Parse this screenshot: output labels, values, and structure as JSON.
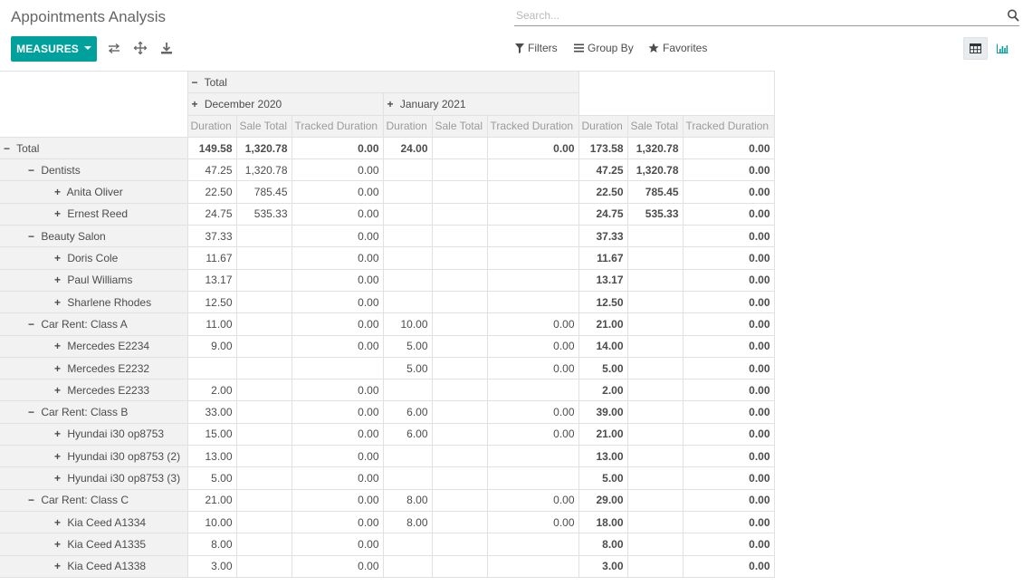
{
  "breadcrumb": "Appointments Analysis",
  "search": {
    "placeholder": "Search..."
  },
  "toolbar": {
    "measures_label": "MEASURES",
    "filters_label": "Filters",
    "groupby_label": "Group By",
    "favorites_label": "Favorites"
  },
  "colors": {
    "accent": "#00a09d",
    "header_bg": "#f2f2f2",
    "border": "#dee2e6"
  },
  "pivot": {
    "col_total_label": "Total",
    "col_groups": [
      "December 2020",
      "January 2021"
    ],
    "measures": [
      "Duration",
      "Sale Total",
      "Tracked Duration"
    ],
    "rows": [
      {
        "label": "Total",
        "level": 0,
        "expand": "minus",
        "values": [
          "149.58",
          "1,320.78",
          "0.00",
          "24.00",
          "",
          "0.00",
          "173.58",
          "1,320.78",
          "0.00"
        ]
      },
      {
        "label": "Dentists",
        "level": 1,
        "expand": "minus",
        "values": [
          "47.25",
          "1,320.78",
          "0.00",
          "",
          "",
          "",
          "47.25",
          "1,320.78",
          "0.00"
        ]
      },
      {
        "label": "Anita Oliver",
        "level": 2,
        "expand": "plus",
        "values": [
          "22.50",
          "785.45",
          "0.00",
          "",
          "",
          "",
          "22.50",
          "785.45",
          "0.00"
        ]
      },
      {
        "label": "Ernest Reed",
        "level": 2,
        "expand": "plus",
        "values": [
          "24.75",
          "535.33",
          "0.00",
          "",
          "",
          "",
          "24.75",
          "535.33",
          "0.00"
        ]
      },
      {
        "label": "Beauty Salon",
        "level": 1,
        "expand": "minus",
        "values": [
          "37.33",
          "",
          "0.00",
          "",
          "",
          "",
          "37.33",
          "",
          "0.00"
        ]
      },
      {
        "label": "Doris Cole",
        "level": 2,
        "expand": "plus",
        "values": [
          "11.67",
          "",
          "0.00",
          "",
          "",
          "",
          "11.67",
          "",
          "0.00"
        ]
      },
      {
        "label": "Paul Williams",
        "level": 2,
        "expand": "plus",
        "values": [
          "13.17",
          "",
          "0.00",
          "",
          "",
          "",
          "13.17",
          "",
          "0.00"
        ]
      },
      {
        "label": "Sharlene Rhodes",
        "level": 2,
        "expand": "plus",
        "values": [
          "12.50",
          "",
          "0.00",
          "",
          "",
          "",
          "12.50",
          "",
          "0.00"
        ]
      },
      {
        "label": "Car Rent: Class A",
        "level": 1,
        "expand": "minus",
        "values": [
          "11.00",
          "",
          "0.00",
          "10.00",
          "",
          "0.00",
          "21.00",
          "",
          "0.00"
        ]
      },
      {
        "label": "Mercedes E2234",
        "level": 2,
        "expand": "plus",
        "values": [
          "9.00",
          "",
          "0.00",
          "5.00",
          "",
          "0.00",
          "14.00",
          "",
          "0.00"
        ]
      },
      {
        "label": "Mercedes E2232",
        "level": 2,
        "expand": "plus",
        "values": [
          "",
          "",
          "",
          "5.00",
          "",
          "0.00",
          "5.00",
          "",
          "0.00"
        ]
      },
      {
        "label": "Mercedes E2233",
        "level": 2,
        "expand": "plus",
        "values": [
          "2.00",
          "",
          "0.00",
          "",
          "",
          "",
          "2.00",
          "",
          "0.00"
        ]
      },
      {
        "label": "Car Rent: Class B",
        "level": 1,
        "expand": "minus",
        "values": [
          "33.00",
          "",
          "0.00",
          "6.00",
          "",
          "0.00",
          "39.00",
          "",
          "0.00"
        ]
      },
      {
        "label": "Hyundai i30 op8753",
        "level": 2,
        "expand": "plus",
        "values": [
          "15.00",
          "",
          "0.00",
          "6.00",
          "",
          "0.00",
          "21.00",
          "",
          "0.00"
        ]
      },
      {
        "label": "Hyundai i30 op8753 (2)",
        "level": 2,
        "expand": "plus",
        "values": [
          "13.00",
          "",
          "0.00",
          "",
          "",
          "",
          "13.00",
          "",
          "0.00"
        ]
      },
      {
        "label": "Hyundai i30 op8753 (3)",
        "level": 2,
        "expand": "plus",
        "values": [
          "5.00",
          "",
          "0.00",
          "",
          "",
          "",
          "5.00",
          "",
          "0.00"
        ]
      },
      {
        "label": "Car Rent: Class C",
        "level": 1,
        "expand": "minus",
        "values": [
          "21.00",
          "",
          "0.00",
          "8.00",
          "",
          "0.00",
          "29.00",
          "",
          "0.00"
        ]
      },
      {
        "label": "Kia Ceed A1334",
        "level": 2,
        "expand": "plus",
        "values": [
          "10.00",
          "",
          "0.00",
          "8.00",
          "",
          "0.00",
          "18.00",
          "",
          "0.00"
        ]
      },
      {
        "label": "Kia Ceed A1335",
        "level": 2,
        "expand": "plus",
        "values": [
          "8.00",
          "",
          "0.00",
          "",
          "",
          "",
          "8.00",
          "",
          "0.00"
        ]
      },
      {
        "label": "Kia Ceed A1338",
        "level": 2,
        "expand": "plus",
        "values": [
          "3.00",
          "",
          "0.00",
          "",
          "",
          "",
          "3.00",
          "",
          "0.00"
        ]
      }
    ]
  }
}
